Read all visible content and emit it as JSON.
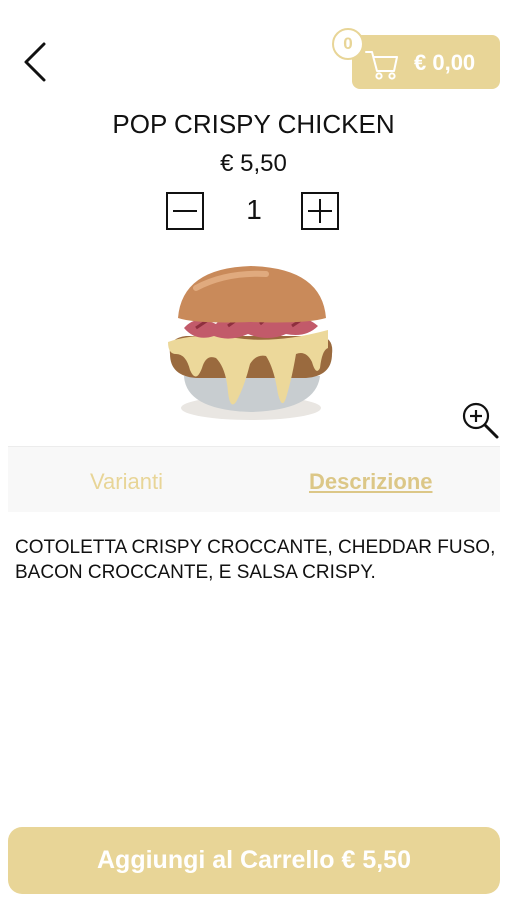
{
  "header": {
    "back_icon": "chevron-left-icon",
    "cart": {
      "icon": "shopping-cart-icon",
      "count": "0",
      "total": "€ 0,00"
    }
  },
  "product": {
    "title": "POP CRISPY CHICKEN",
    "price": "€ 5,50",
    "quantity": "1",
    "image": "burger-image",
    "zoom_icon": "zoom-in-icon"
  },
  "tabs": [
    {
      "label": "Varianti",
      "active": false
    },
    {
      "label": "Descrizione",
      "active": true
    }
  ],
  "description": "COTOLETTA CRISPY CROCCANTE, CHEDDAR FUSO, BACON CROCCANTE, E SALSA CRISPY.",
  "add_to_cart": {
    "label": "Aggiungi al Carrello € 5,50"
  },
  "colors": {
    "accent": "#e8d597",
    "tab_active": "#dcc787",
    "text": "#111111",
    "tabs_background": "#f8f8f8"
  }
}
